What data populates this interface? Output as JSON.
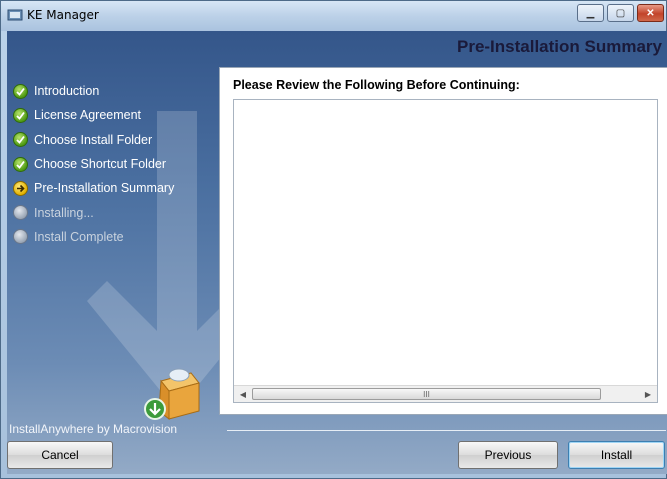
{
  "window": {
    "title": "KE Manager"
  },
  "header": {
    "title": "Pre-Installation Summary"
  },
  "steps": [
    {
      "label": "Introduction",
      "state": "done"
    },
    {
      "label": "License Agreement",
      "state": "done"
    },
    {
      "label": "Choose Install Folder",
      "state": "done"
    },
    {
      "label": "Choose Shortcut Folder",
      "state": "done"
    },
    {
      "label": "Pre-Installation Summary",
      "state": "current"
    },
    {
      "label": "Installing...",
      "state": "pending"
    },
    {
      "label": "Install Complete",
      "state": "pending"
    }
  ],
  "panel": {
    "heading": "Please Review the Following Before Continuing:",
    "summary_text": ""
  },
  "footer": {
    "brand": "InstallAnywhere by Macrovision",
    "cancel_label": "Cancel",
    "previous_label": "Previous",
    "install_label": "Install"
  }
}
